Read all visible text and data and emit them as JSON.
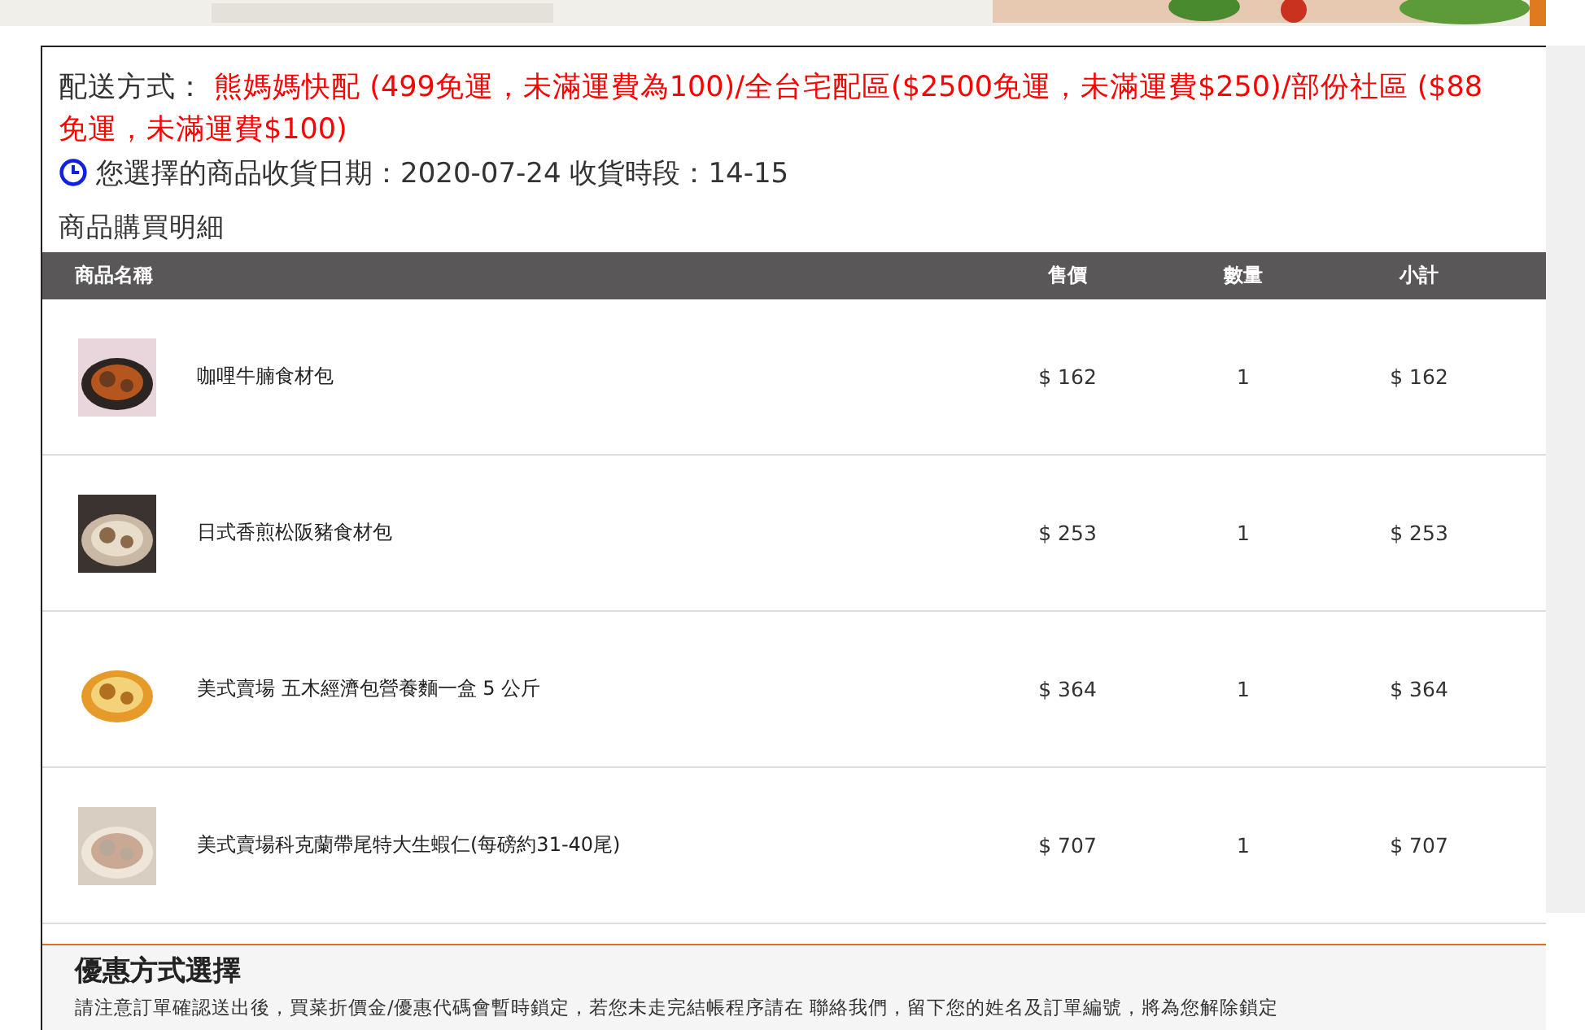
{
  "delivery": {
    "label": "配送方式：",
    "text": "熊媽媽快配 (499免運，未滿運費為100)/全台宅配區($2500免運，未滿運費$250)/部份社區 ($88",
    "text_line2": "免運，未滿運費$100)"
  },
  "schedule": {
    "text": "您選擇的商品收貨日期：2020-07-24  收貨時段：14-15"
  },
  "section_title": "商品購買明細",
  "table": {
    "columns": [
      "商品名稱",
      "售價",
      "數量",
      "小計"
    ],
    "rows": [
      {
        "name": "咖哩牛腩食材包",
        "price": "$ 162",
        "qty": "1",
        "subtotal": "$ 162"
      },
      {
        "name": "日式香煎松阪豬食材包",
        "price": "$ 253",
        "qty": "1",
        "subtotal": "$ 253"
      },
      {
        "name": "美式賣場 五木經濟包營養麵一盒 5 公斤",
        "price": "$ 364",
        "qty": "1",
        "subtotal": "$ 364"
      },
      {
        "name": "美式賣場科克蘭帶尾特大生蝦仁(每磅約31-40尾)",
        "price": "$ 707",
        "qty": "1",
        "subtotal": "$ 707"
      }
    ]
  },
  "discount": {
    "title": "優惠方式選擇",
    "note": "請注意訂單確認送出後，買菜折價金/優惠代碼會暫時鎖定，若您未走完結帳程序請在 聯絡我們，留下您的姓名及訂單編號，將為您解除鎖定"
  }
}
